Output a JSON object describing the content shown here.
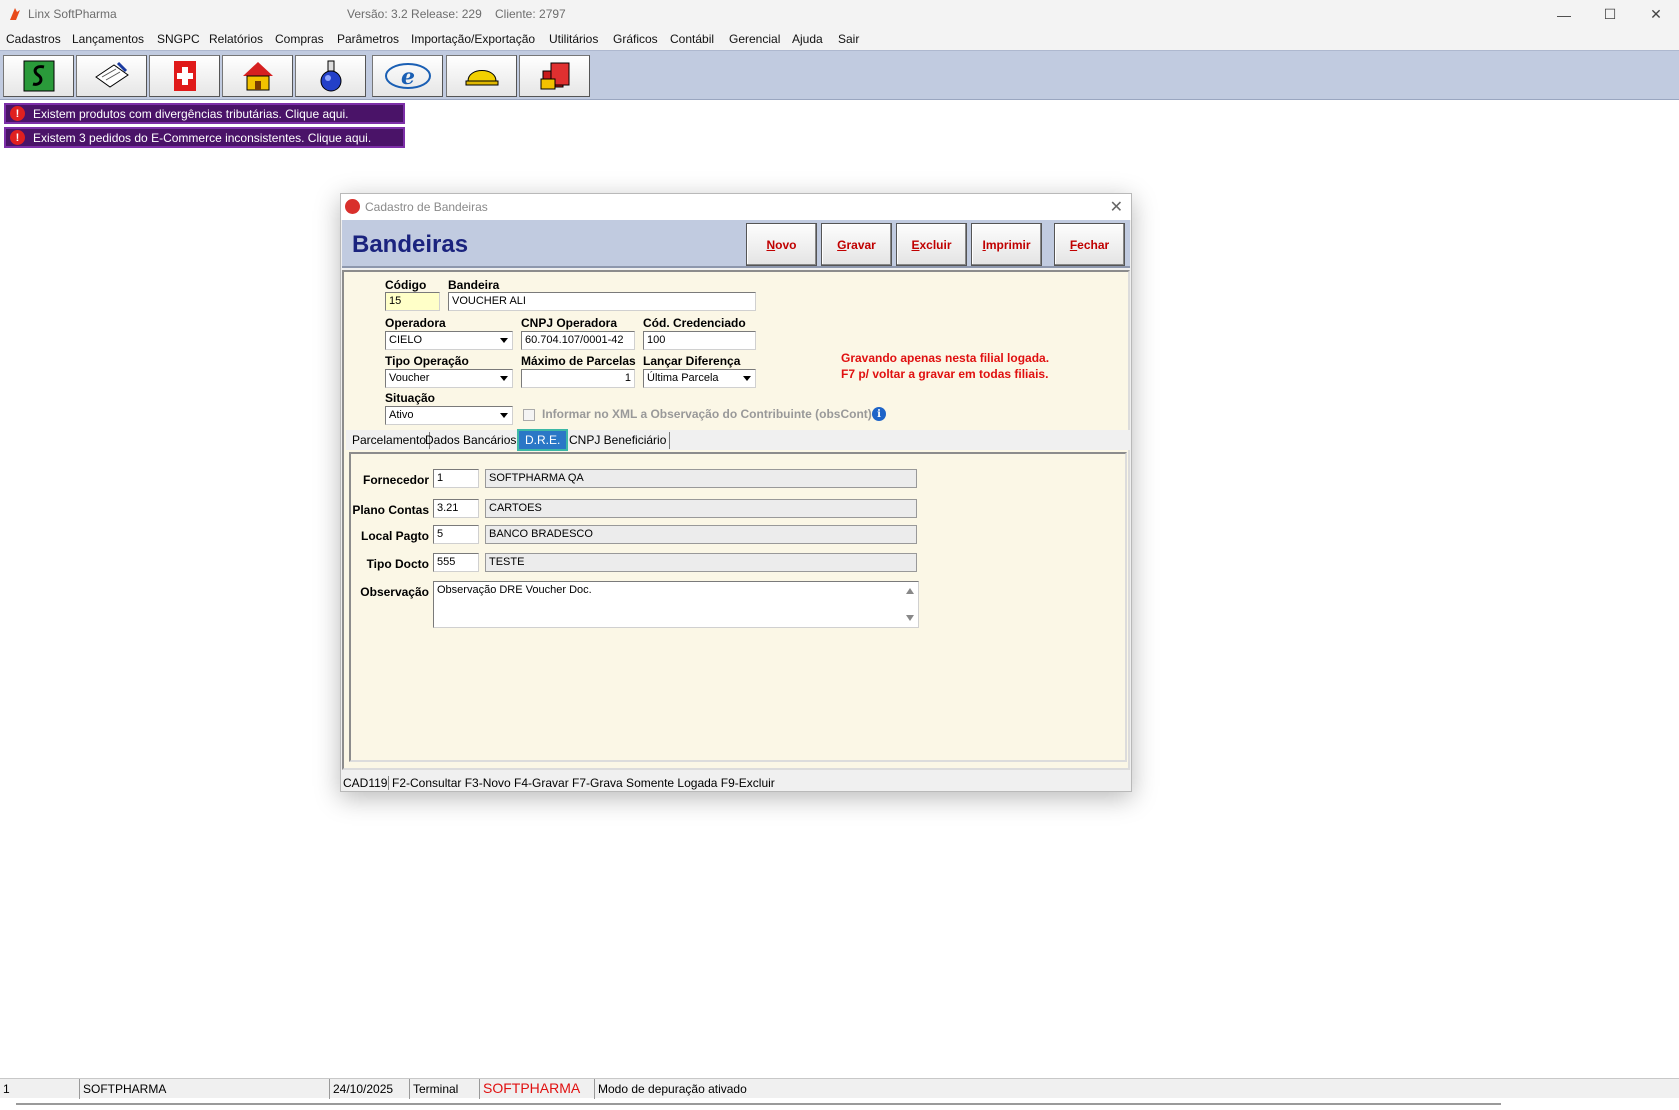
{
  "window": {
    "title": "Linx SoftPharma",
    "version": "Versão: 3.2 Release: 229",
    "client": "Cliente: 2797",
    "minimize": "—",
    "maximize": "☐",
    "close": "✕"
  },
  "menu": [
    "Cadastros",
    "Lançamentos",
    "SNGPC",
    "Relatórios",
    "Compras",
    "Parâmetros",
    "Importação/Exportação",
    "Utilitários",
    "Gráficos",
    "Contábil",
    "Gerencial",
    "Ajuda",
    "Sair"
  ],
  "toolbar": {
    "buttons": [
      "money-icon",
      "clipboard-icon",
      "red-cross-icon",
      "house-icon",
      "flask-icon",
      "nfe-icon",
      "helmet-icon",
      "books-icon"
    ]
  },
  "alerts": [
    "Existem produtos com divergências tributárias. Clique aqui.",
    "Existem 3 pedidos do E-Commerce inconsistentes. Clique aqui."
  ],
  "dialog": {
    "title": "Cadastro de Bandeiras",
    "heading": "Bandeiras",
    "buttons": {
      "novo": {
        "u": "N",
        "rest": "ovo"
      },
      "gravar": {
        "u": "G",
        "rest": "ravar"
      },
      "excluir": {
        "u": "E",
        "rest": "xcluir"
      },
      "imprimir": {
        "u": "I",
        "rest": "mprimir"
      },
      "fechar": {
        "u": "F",
        "rest": "echar"
      }
    },
    "form": {
      "codigo_label": "Código",
      "codigo_value": "15",
      "bandeira_label": "Bandeira",
      "bandeira_value": "VOUCHER ALI",
      "operadora_label": "Operadora",
      "operadora_value": "CIELO",
      "cnpj_label": "CNPJ Operadora",
      "cnpj_value": "60.704.107/0001-42",
      "credenciado_label": "Cód. Credenciado",
      "credenciado_value": "100",
      "tipo_operacao_label": "Tipo Operação",
      "tipo_operacao_value": "Voucher",
      "max_parcelas_label": "Máximo de Parcelas",
      "max_parcelas_value": "1",
      "lancar_diferenca_label": "Lançar Diferença",
      "lancar_diferenca_value": "Última Parcela",
      "situacao_label": "Situação",
      "situacao_value": "Ativo",
      "xml_checkbox_label": "Informar no XML a Observação do Contribuinte (obsCont)",
      "warning_line1": "Gravando apenas nesta filial logada.",
      "warning_line2": "F7 p/ voltar a gravar em todas filiais."
    },
    "tabs": [
      "Parcelamento",
      "Dados Bancários",
      "D.R.E.",
      "CNPJ Beneficiário"
    ],
    "active_tab": "D.R.E.",
    "dre": {
      "fornecedor_label": "Fornecedor",
      "fornecedor_code": "1",
      "fornecedor_name": "SOFTPHARMA QA",
      "plano_label": "Plano Contas",
      "plano_code": "3.21",
      "plano_name": "CARTOES",
      "local_label": "Local Pagto",
      "local_code": "5",
      "local_name": "BANCO BRADESCO",
      "tipo_label": "Tipo Docto",
      "tipo_code": "555",
      "tipo_name": "TESTE",
      "obs_label": "Observação",
      "obs_value": "Observação DRE Voucher Doc."
    },
    "status": {
      "code": "CAD119",
      "shortcuts": "F2-Consultar  F3-Novo  F4-Gravar  F7-Grava Somente Logada  F9-Excluir"
    }
  },
  "statusbar": {
    "cell1": "1",
    "cell2": "SOFTPHARMA",
    "date": "24/10/2025",
    "terminal": "Terminal",
    "brand": "SOFTPHARMA",
    "mode": "Modo de depuração ativado"
  },
  "colors": {
    "toolbar_bg": "#c1cbe0",
    "alert_bg": "#4a1368",
    "button_text": "#c00000",
    "heading": "#1a237e",
    "warning": "#e01010",
    "active_tab": "#2a77c6"
  }
}
